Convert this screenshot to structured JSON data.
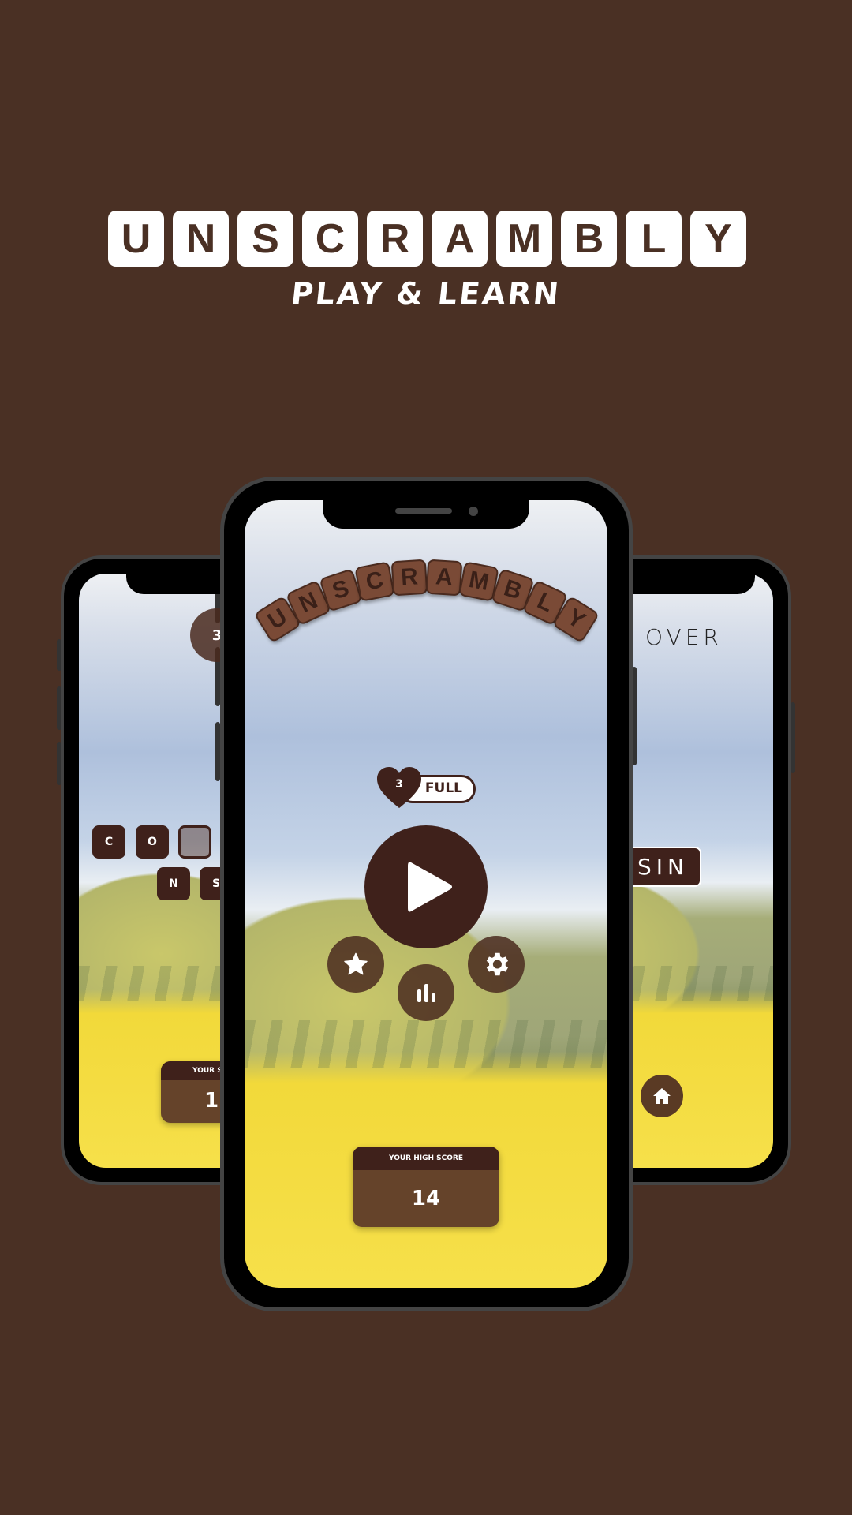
{
  "logo": {
    "letters": [
      "U",
      "N",
      "S",
      "C",
      "R",
      "A",
      "M",
      "B",
      "L",
      "Y"
    ],
    "tagline": "PLAY & LEARN"
  },
  "colors": {
    "background": "#4a3024",
    "tile_dark": "#3f211b",
    "tile_arc": "#7a4a36"
  },
  "center_phone": {
    "arc_title": [
      "U",
      "N",
      "S",
      "C",
      "R",
      "A",
      "M",
      "B",
      "L",
      "Y"
    ],
    "lives": {
      "count": "3",
      "status": "FULL",
      "icon": "heart-icon"
    },
    "buttons": {
      "play": "play-icon",
      "favorites": "star-icon",
      "stats": "bar-chart-icon",
      "settings": "gear-icon"
    },
    "high_score": {
      "label": "YOUR HIGH SCORE",
      "value": "14"
    }
  },
  "left_phone": {
    "lives_badge": "3",
    "answer_tiles": [
      "C",
      "O",
      ""
    ],
    "scrambled_tiles": [
      "N",
      "S"
    ],
    "score_card": {
      "label": "YOUR S",
      "value": "1"
    }
  },
  "right_phone": {
    "title": "OVER",
    "answer_box": "USIN",
    "home_button": "home-icon"
  }
}
